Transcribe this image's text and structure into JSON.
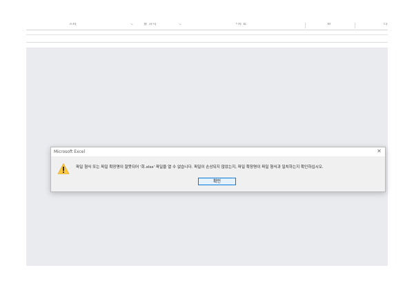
{
  "ribbon": {
    "labels": [
      "스타",
      "표 서식",
      "└자 트",
      "보",
      "다"
    ]
  },
  "dialog": {
    "title": "Microsoft Excel",
    "close_glyph": "✕",
    "icon": "warning-icon",
    "message": "파일 형식 또는 파일 확장명이 잘못되어 '회.xlsx' 파일을 열 수 없습니다. 파일이 손상되지 않았는지, 파일 확장명이 파일 형식과 일치하는지 확인하십시오.",
    "ok_label": "확인"
  },
  "colors": {
    "workspace": "#e9ebef",
    "dialog_bg": "#f0f0f0",
    "button_border": "#0078d7",
    "warning": "#ffc83d"
  }
}
